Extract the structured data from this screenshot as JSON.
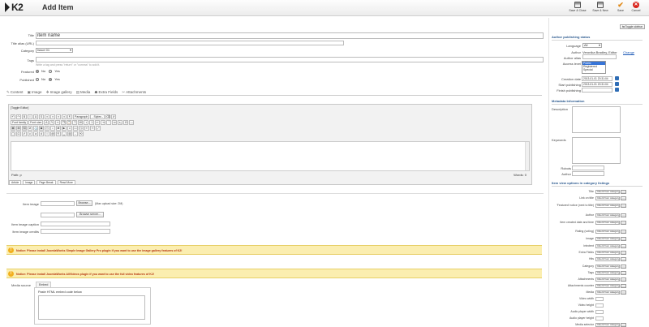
{
  "header": {
    "logo_text": "K2",
    "title": "Add Item",
    "toolbar": {
      "save_close": "Save & Close",
      "save_new": "Save & New",
      "save": "Save",
      "cancel": "Cancel"
    }
  },
  "form": {
    "title_label": "Title",
    "title_value": "item name",
    "alias_label": "Title alias (URL)",
    "category_label": "Category",
    "category_value": "Issue 01",
    "tags_label": "Tags",
    "tags_hint": "Write a tag and press \"return\" or \"comma\" to add it.",
    "featured_label": "Featured",
    "published_label": "Published",
    "no": "No",
    "yes": "Yes"
  },
  "tabs": [
    {
      "icon": "✎",
      "label": "Content"
    },
    {
      "icon": "▣",
      "label": "Image"
    },
    {
      "icon": "❖",
      "label": "Image gallery"
    },
    {
      "icon": "▤",
      "label": "Media"
    },
    {
      "icon": "☗",
      "label": "Extra Fields"
    },
    {
      "icon": "✂",
      "label": "Attachments"
    }
  ],
  "editor": {
    "toggle": "[Toggle Editor]",
    "paragraph": "Paragraph",
    "styles": "- Styles -",
    "font_family": "Font family",
    "font_size": "Font size",
    "path": "Path: p",
    "words": "Words: 0",
    "buttons": {
      "article": "Article",
      "image": "Image",
      "page_break": "Page Break",
      "read_more": "Read More"
    }
  },
  "image": {
    "item_image_label": "Item image",
    "browse": "Browse...",
    "max_size": "(Max upload size: 2M)",
    "browse_server": "Browse server...",
    "caption_label": "Item image caption",
    "credits_label": "Item image credits"
  },
  "notices": {
    "gallery": "Notice: Please install JoomlaWorks Simple Image Gallery Pro plugin if you want to use the image gallery features of K2!",
    "video": "Notice: Please install JoomlaWorks AllVideos plugin if you want to use the full video features of K2!"
  },
  "media": {
    "source_label": "Media source",
    "embed_tab": "Embed",
    "paste_label": "Paste HTML embed code below"
  },
  "sidebar": {
    "toggle": "Toggle sidebar",
    "publishing_title": "Author publishing status",
    "language_label": "Language",
    "language_value": "All",
    "author_label": "Author",
    "author_value": "Veronika Bradley, Editor",
    "change_link": "Change",
    "author_alias_label": "Author alias",
    "access_label": "Access level",
    "access_options": [
      "Public",
      "Registered",
      "Special"
    ],
    "creation_label": "Creation date",
    "creation_value": "2013-01-01 20:31:04",
    "start_label": "Start publishing",
    "start_value": "2013-01-01 20:31:04",
    "finish_label": "Finish publishing",
    "metadata_title": "Metadata Information",
    "description_label": "Description",
    "keywords_label": "Keywords",
    "robots_label": "Robots",
    "meta_author_label": "Author",
    "view_options_title": "Item view options in category listings",
    "inherit_value": "Inherit from category",
    "view_options": [
      "Title",
      "Link on title",
      "'Featured' notice (next to title)",
      "Author",
      "Item created date and time",
      "Rating (voting)",
      "Image",
      "Introtext",
      "Extra Fields",
      "Hits",
      "Category",
      "Tags",
      "Attachments",
      "Attachments counter",
      "Media",
      "Video width",
      "Video height",
      "Audio player width",
      "Audio player height",
      "Media selector"
    ]
  }
}
